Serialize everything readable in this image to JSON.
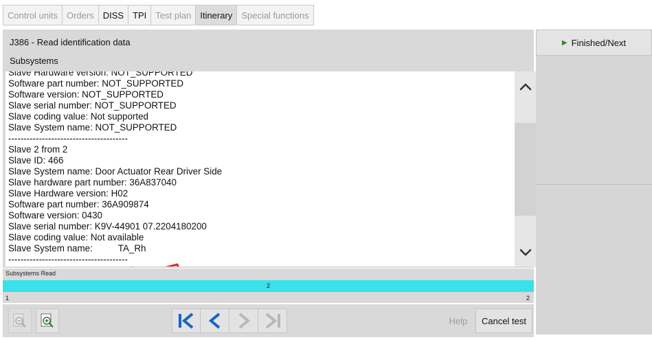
{
  "tabs": [
    {
      "label": "Control units",
      "state": "inactive"
    },
    {
      "label": "Orders",
      "state": "inactive"
    },
    {
      "label": "DISS",
      "state": "dark"
    },
    {
      "label": "TPI",
      "state": "dark"
    },
    {
      "label": "Test plan",
      "state": "inactive"
    },
    {
      "label": "Itinerary",
      "state": "active"
    },
    {
      "label": "Special functions",
      "state": "inactive"
    }
  ],
  "header": {
    "title": "J386 - Read identification data",
    "subtitle": "Subsystems"
  },
  "content_lines": [
    "Slave Hardware version: NOT_SUPPORTED",
    "Software part number: NOT_SUPPORTED",
    "Software version: NOT_SUPPORTED",
    "Slave serial number: NOT_SUPPORTED",
    "Slave coding value: Not supported",
    "Slave System name: NOT_SUPPORTED",
    "---------------------------------------",
    "Slave 2 from 2",
    "Slave ID: 466",
    "Slave System name: Door Actuator Rear Driver Side",
    "Slave hardware part number: 36A837040",
    "Slave Hardware version: H02",
    "Software part number: 36A909874",
    "Software version: 0430",
    "Slave serial number: K9V-44901 07.2204180200",
    "Slave coding value: Not available",
    "Slave System name:          TA_Rh",
    "---------------------------------------"
  ],
  "right_panel": {
    "finished_label": "Finished/Next"
  },
  "progress": {
    "label": "Subsystems Read",
    "value": "2",
    "min": "1",
    "max": "2",
    "fraction": 1.0,
    "color": "#38e2ea"
  },
  "toolbar": {
    "help_label": "Help",
    "cancel_label": "Cancel test"
  },
  "icons": {
    "scroll_up": "chevron-up-icon",
    "scroll_down": "chevron-down-icon",
    "nav_first": "skip-first-icon",
    "nav_prev": "chevron-left-icon",
    "nav_next": "chevron-right-icon",
    "nav_last": "skip-last-icon",
    "zoom_out": "zoom-out-icon",
    "zoom_in": "zoom-in-icon",
    "finished": "play-icon"
  },
  "colors": {
    "nav_active": "#1565c8",
    "nav_disabled": "#b8b8b8",
    "annotation_arrow": "#e0262b",
    "progress_fill": "#38e2ea"
  }
}
